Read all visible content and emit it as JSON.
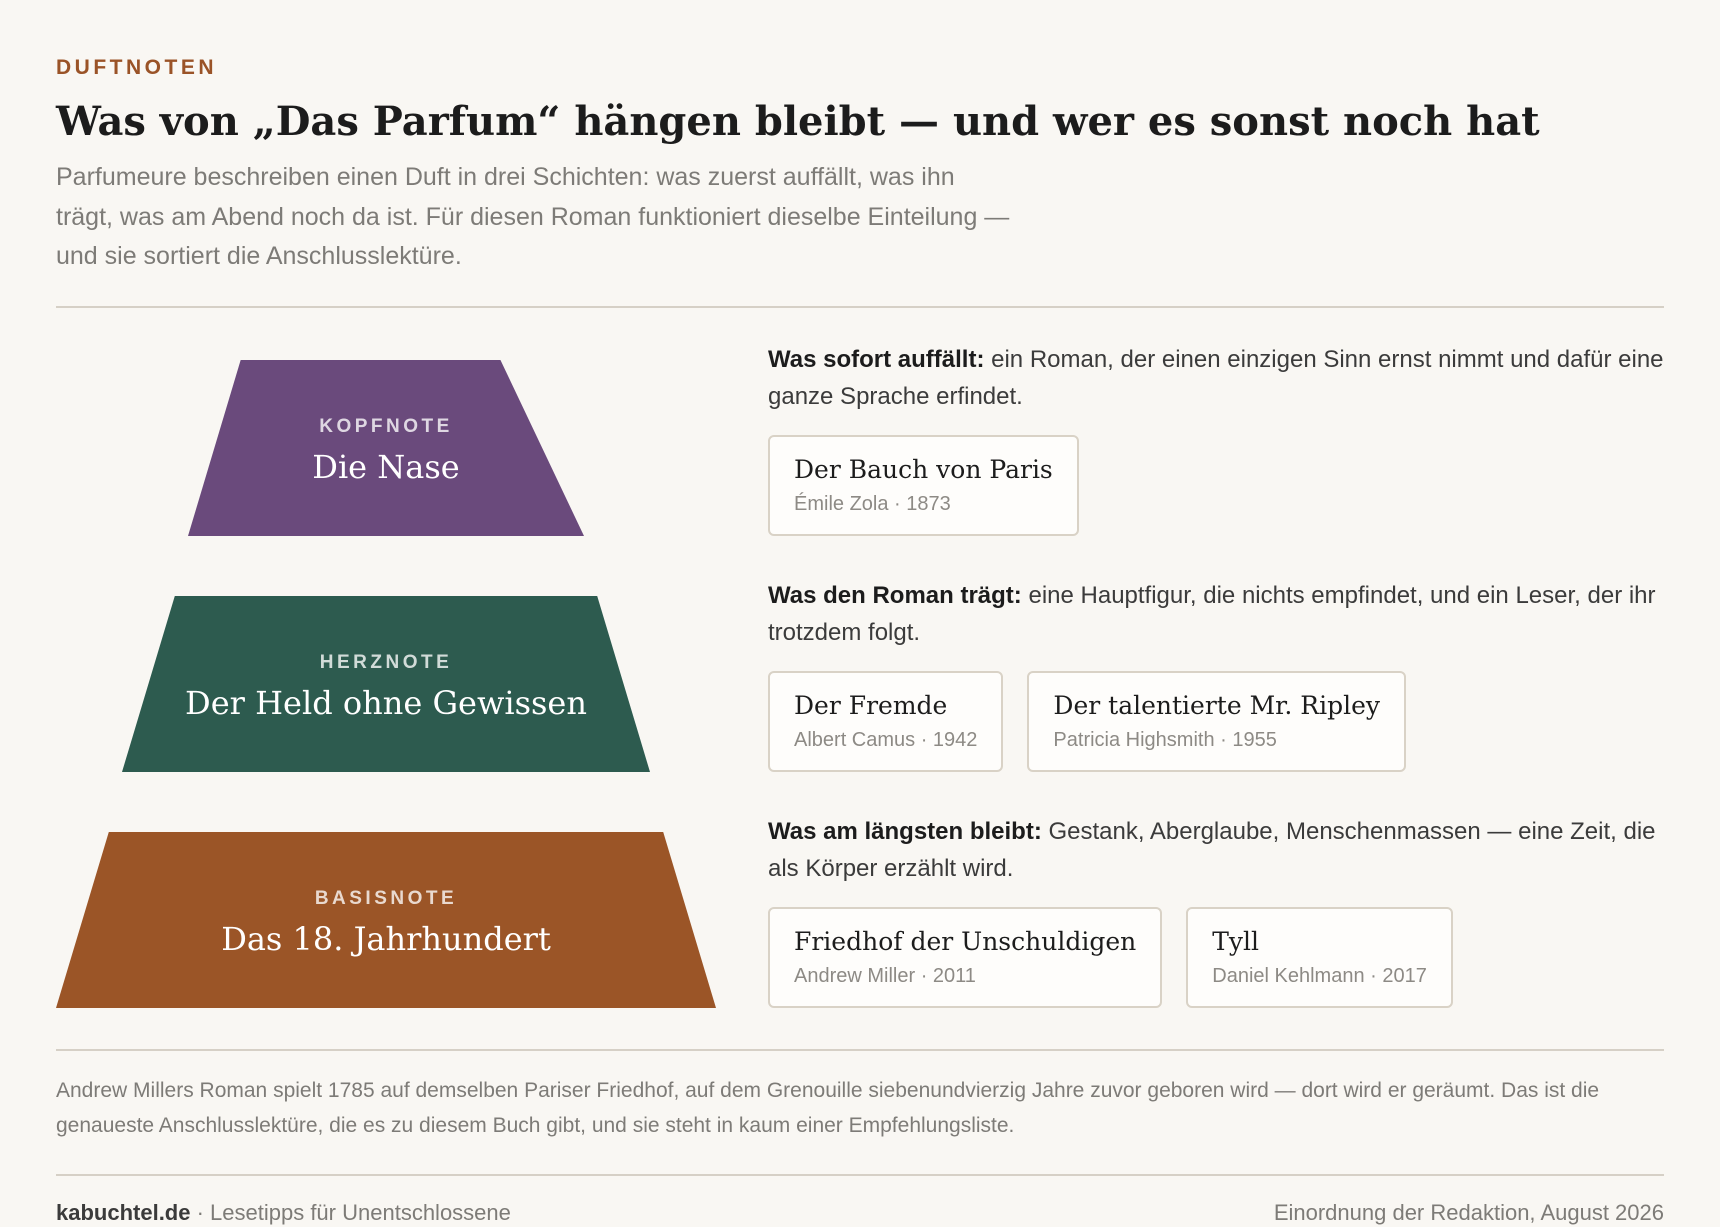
{
  "eyebrow": "DUFTNOTEN",
  "title": "Was von „Das Parfum“ hängen bleibt — und wer es sonst noch hat",
  "intro": "Parfumeure beschreiben einen Duft in drei Schichten: was zuerst auffällt, was ihn trägt, was am Abend noch da ist. Für diesen Roman funktioniert dieselbe Einteilung — und sie sortiert die Anschlusslektüre.",
  "layers": [
    {
      "kicker": "KOPFNOTE",
      "name": "Die Nase",
      "color": "#6a4a7c",
      "lead": "Was sofort auffällt:",
      "text": " ein Roman, der einen einzigen Sinn ernst nimmt und dafür eine ganze Sprache erfindet.",
      "books": [
        {
          "title": "Der Bauch von Paris",
          "meta": "Émile Zola · 1873"
        }
      ]
    },
    {
      "kicker": "HERZNOTE",
      "name": "Der Held ohne Gewissen",
      "color": "#2d5b4f",
      "lead": "Was den Roman trägt:",
      "text": " eine Hauptfigur, die nichts empfindet, und ein Leser, der ihr trotzdem folgt.",
      "books": [
        {
          "title": "Der Fremde",
          "meta": "Albert Camus · 1942"
        },
        {
          "title": "Der talentierte Mr. Ripley",
          "meta": "Patricia Highsmith · 1955"
        }
      ]
    },
    {
      "kicker": "BASISNOTE",
      "name": "Das 18. Jahrhundert",
      "color": "#9b5527",
      "lead": "Was am längsten bleibt:",
      "text": " Gestank, Aberglaube, Menschenmassen — eine Zeit, die als Körper erzählt wird.",
      "books": [
        {
          "title": "Friedhof der Unschuldigen",
          "meta": "Andrew Miller · 2011"
        },
        {
          "title": "Tyll",
          "meta": "Daniel Kehlmann · 2017"
        }
      ]
    }
  ],
  "note": "Andrew Millers Roman spielt 1785 auf demselben Pariser Friedhof, auf dem Grenouille siebenundvierzig Jahre zuvor geboren wird — dort wird er geräumt. Das ist die genaueste Anschlusslektüre, die es zu diesem Buch gibt, und sie steht in kaum einer Empfehlungsliste.",
  "footer": {
    "brand": "kabuchtel.de",
    "tagline": " · Lesetipps für Unentschlossene",
    "credit": "Einordnung der Redaktion, August 2026"
  }
}
